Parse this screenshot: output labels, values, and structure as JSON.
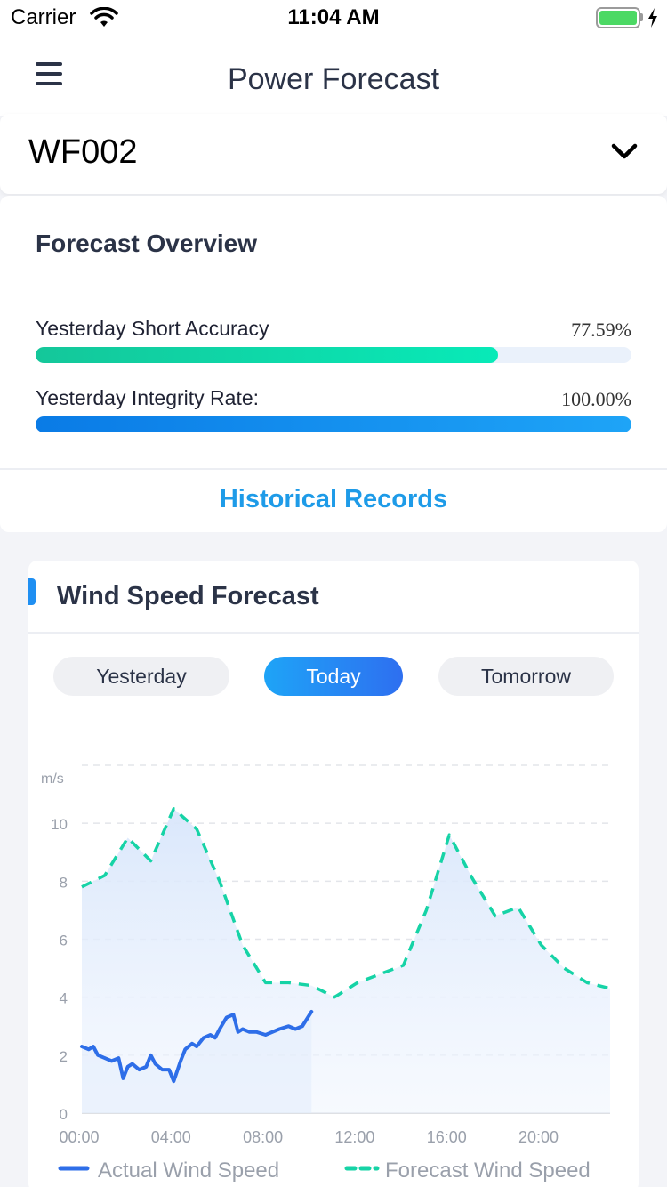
{
  "status": {
    "carrier": "Carrier",
    "time": "11:04 AM"
  },
  "nav": {
    "title": "Power Forecast"
  },
  "selector": {
    "value": "WF002"
  },
  "overview": {
    "title": "Forecast Overview",
    "metrics": [
      {
        "label": "Yesterday Short Accuracy",
        "value": "77.59%",
        "fraction": 0.7759
      },
      {
        "label": "Yesterday Integrity Rate:",
        "value": "100.00%",
        "fraction": 1.0
      }
    ],
    "link": "Historical Records"
  },
  "wind": {
    "title": "Wind Speed Forecast",
    "tabs": [
      "Yesterday",
      "Today",
      "Tomorrow"
    ],
    "active_tab": "Today"
  },
  "colors": {
    "accent": "#1e9be8",
    "green": "#14c79a",
    "actual_line": "#2e6ee8",
    "forecast_line": "#16d3a6"
  },
  "chart_data": {
    "type": "line",
    "ylabel": "m/s",
    "ylim": [
      0,
      12
    ],
    "yticks": [
      0,
      2,
      4,
      6,
      8,
      10
    ],
    "xlim": [
      0,
      23
    ],
    "xtick_labels": [
      "00:00",
      "04:00",
      "08:00",
      "12:00",
      "16:00",
      "20:00"
    ],
    "xtick_values": [
      0,
      4,
      8,
      12,
      16,
      20
    ],
    "grid": true,
    "legend": "bottom",
    "series": [
      {
        "name": "Actual Wind Speed",
        "style": "solid",
        "x": [
          0,
          0.3,
          0.5,
          0.7,
          1,
          1.3,
          1.6,
          1.8,
          2,
          2.2,
          2.5,
          2.8,
          3,
          3.2,
          3.5,
          3.8,
          4,
          4.3,
          4.5,
          4.8,
          5,
          5.3,
          5.6,
          5.8,
          6,
          6.3,
          6.6,
          6.8,
          7,
          7.3,
          7.6,
          8,
          8.3,
          8.6,
          9,
          9.3,
          9.6,
          10
        ],
        "y": [
          2.3,
          2.2,
          2.3,
          2.0,
          1.9,
          1.8,
          1.9,
          1.2,
          1.6,
          1.7,
          1.5,
          1.6,
          2.0,
          1.7,
          1.5,
          1.5,
          1.1,
          1.8,
          2.2,
          2.4,
          2.3,
          2.6,
          2.7,
          2.6,
          2.9,
          3.3,
          3.4,
          2.8,
          2.9,
          2.8,
          2.8,
          2.7,
          2.8,
          2.9,
          3.0,
          2.9,
          3.0,
          3.5
        ]
      },
      {
        "name": "Forecast Wind Speed",
        "style": "dashed",
        "x": [
          0,
          1,
          2,
          3,
          4,
          5,
          6,
          7,
          8,
          9,
          10,
          11,
          12,
          13,
          14,
          15,
          16,
          17,
          18,
          19,
          20,
          21,
          22,
          23
        ],
        "y": [
          7.8,
          8.2,
          9.5,
          8.7,
          10.5,
          9.8,
          8.0,
          5.8,
          4.5,
          4.5,
          4.4,
          4.0,
          4.5,
          4.8,
          5.1,
          7.0,
          9.6,
          8.1,
          6.8,
          7.1,
          5.8,
          5.0,
          4.5,
          4.3
        ]
      }
    ]
  }
}
